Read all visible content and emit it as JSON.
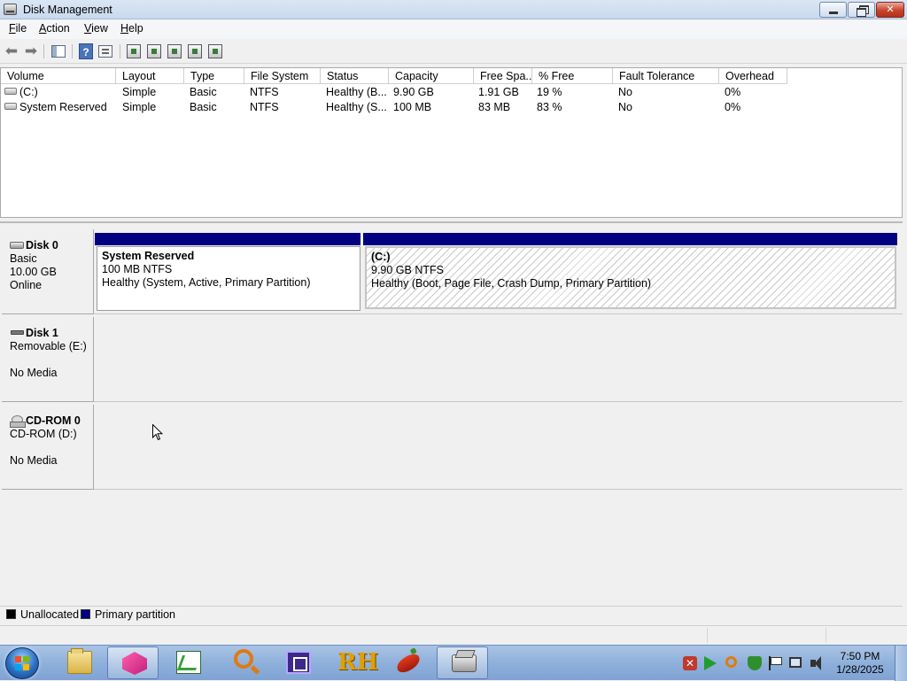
{
  "window": {
    "title": "Disk Management"
  },
  "menu": [
    {
      "label": "File",
      "accel": "F",
      "rest": "ile"
    },
    {
      "label": "Action",
      "accel": "A",
      "rest": "ction"
    },
    {
      "label": "View",
      "accel": "V",
      "rest": "iew"
    },
    {
      "label": "Help",
      "accel": "H",
      "rest": "elp"
    }
  ],
  "volume_table": {
    "columns": [
      "Volume",
      "Layout",
      "Type",
      "File System",
      "Status",
      "Capacity",
      "Free Spa...",
      "% Free",
      "Fault Tolerance",
      "Overhead"
    ],
    "rows": [
      {
        "volume": " (C:)",
        "layout": "Simple",
        "type": "Basic",
        "fs": "NTFS",
        "status": "Healthy (B...",
        "capacity": "9.90 GB",
        "free": "1.91 GB",
        "pct_free": "19 %",
        "fault": "No",
        "overhead": "0%"
      },
      {
        "volume": "System Reserved",
        "layout": "Simple",
        "type": "Basic",
        "fs": "NTFS",
        "status": "Healthy (S...",
        "capacity": "100 MB",
        "free": "83 MB",
        "pct_free": "83 %",
        "fault": "No",
        "overhead": "0%"
      }
    ]
  },
  "disks": [
    {
      "name": "Disk 0",
      "line2": "Basic",
      "line3": "10.00 GB",
      "line4": "Online",
      "partitions": [
        {
          "title": "System Reserved",
          "size": "100 MB NTFS",
          "status": "Healthy (System, Active, Primary Partition)"
        },
        {
          "title": " (C:)",
          "size": "9.90 GB NTFS",
          "status": "Healthy (Boot, Page File, Crash Dump, Primary Partition)"
        }
      ]
    },
    {
      "name": "Disk 1",
      "line2": "Removable (E:)",
      "line3": "",
      "line4": "No Media"
    },
    {
      "name": "CD-ROM 0",
      "line2": "CD-ROM (D:)",
      "line3": "",
      "line4": "No Media"
    }
  ],
  "legend": [
    {
      "label": "Unallocated",
      "color": "#000000"
    },
    {
      "label": "Primary partition",
      "color": "#000080"
    }
  ],
  "colors": {
    "primary_partition": "#000080",
    "unallocated": "#000000"
  },
  "taskbar": {
    "apps": [
      "explorer-icon",
      "cube-app-icon",
      "chart-app-icon",
      "search-app-icon",
      "chip-app-icon",
      "rh-app-icon",
      "pepper-app-icon",
      "disk-management-icon"
    ],
    "clock_time": "7:50 PM",
    "clock_date": "1/28/2025"
  }
}
